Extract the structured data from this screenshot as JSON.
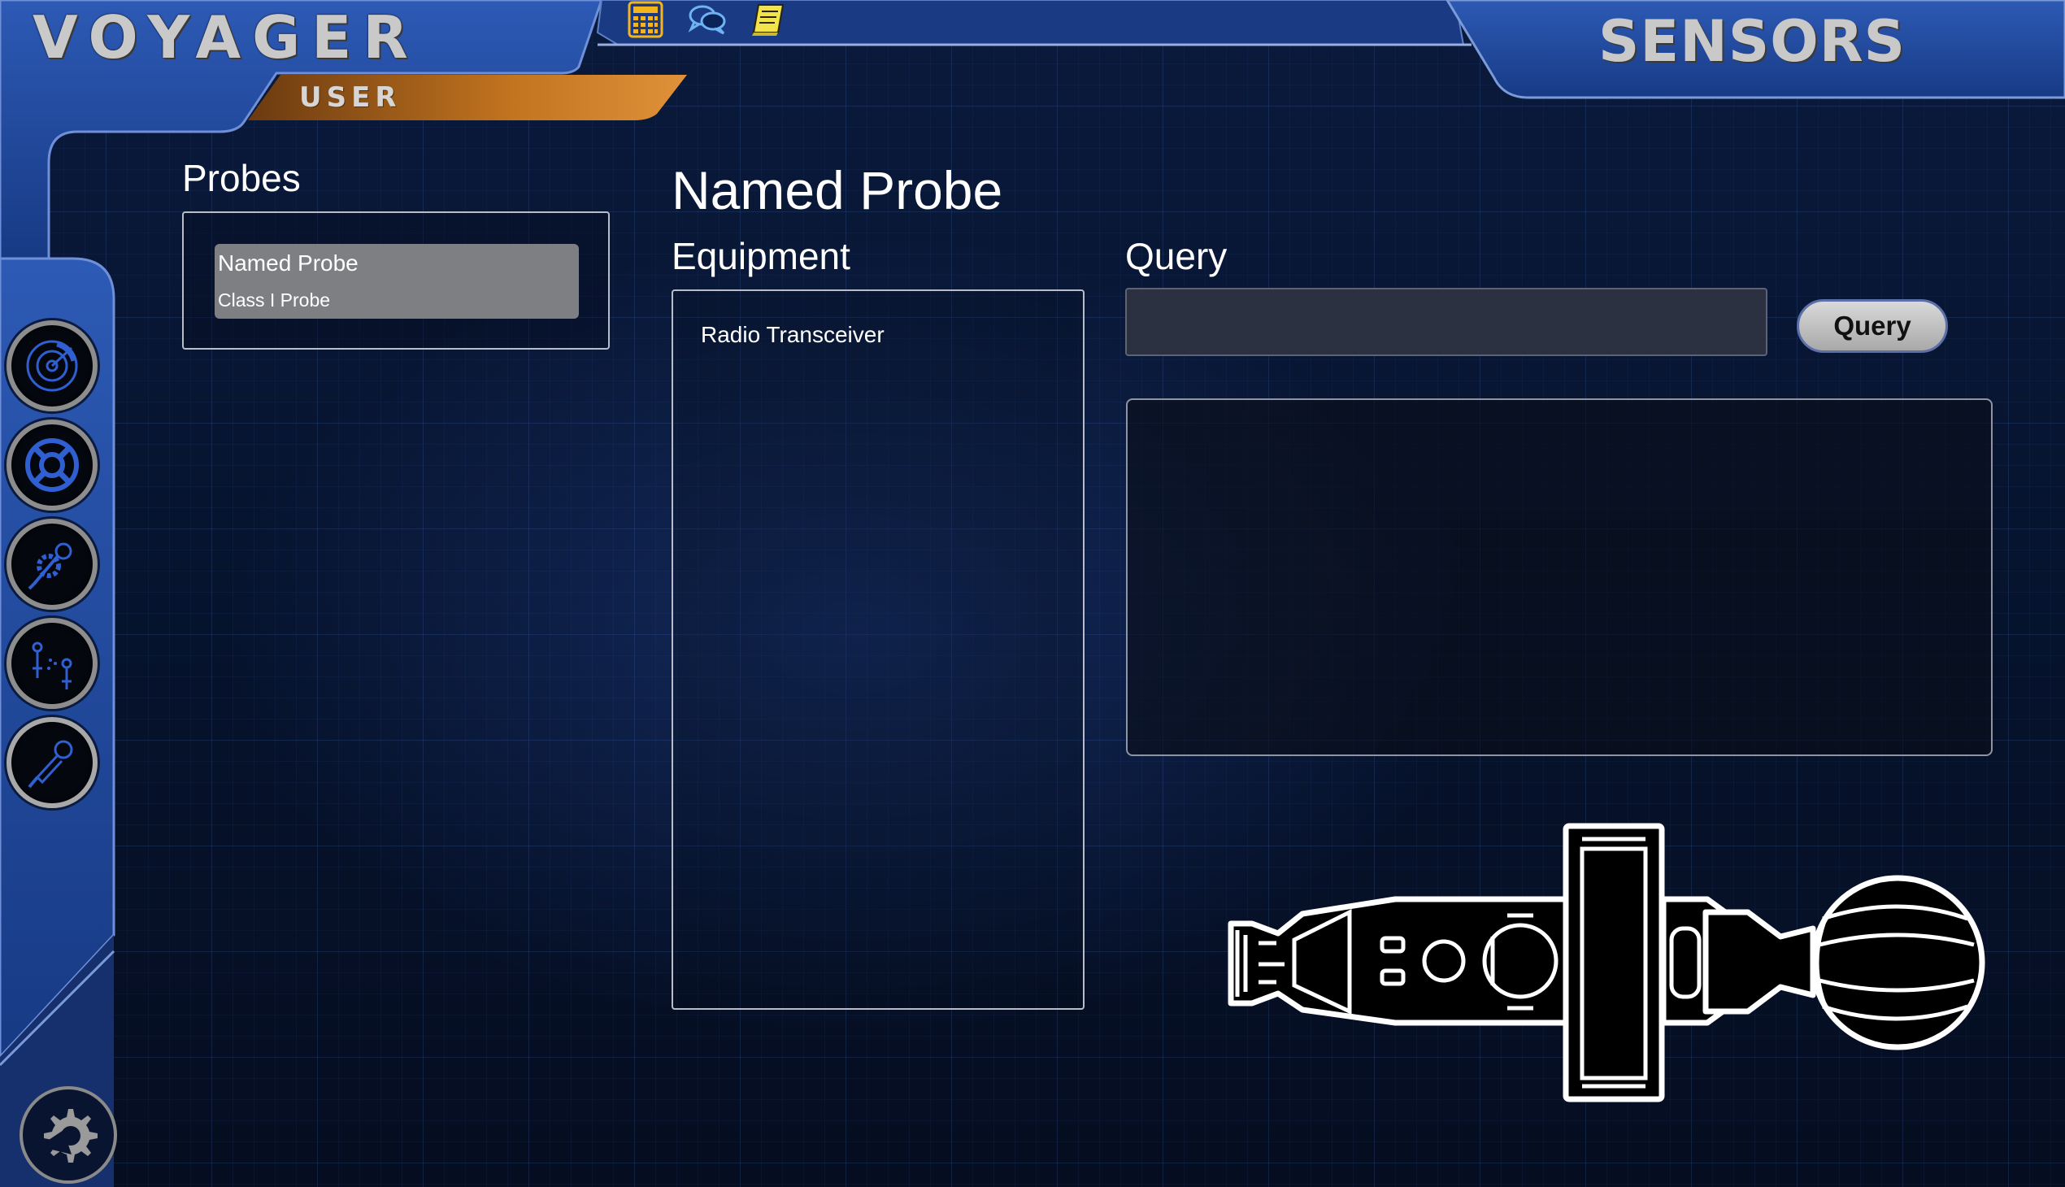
{
  "app": {
    "brand": "VOYAGER",
    "role": "USER",
    "station": "SENSORS"
  },
  "toolbar": {
    "icons": [
      "calculator-icon",
      "chat-icon",
      "notebook-icon"
    ]
  },
  "sidebar": {
    "items": [
      {
        "icon": "radar-icon",
        "active": false
      },
      {
        "icon": "lifebuoy-icon",
        "active": false
      },
      {
        "icon": "probe-construction-icon",
        "active": false
      },
      {
        "icon": "probe-network-icon",
        "active": false
      },
      {
        "icon": "probe-control-icon",
        "active": true
      }
    ],
    "settings_icon": "gear-icon"
  },
  "probes": {
    "title": "Probes",
    "items": [
      {
        "name": "Named Probe",
        "class": "Class I Probe",
        "selected": true
      }
    ]
  },
  "detail": {
    "title": "Named Probe",
    "equipment_title": "Equipment",
    "equipment": [
      "Radio Transceiver"
    ]
  },
  "query": {
    "title": "Query",
    "input_value": "",
    "button_label": "Query",
    "results": ""
  },
  "colors": {
    "accent_orange": "#d98a2c",
    "frame_blue": "#1b3f8f",
    "panel_border": "#b9bdc8"
  }
}
